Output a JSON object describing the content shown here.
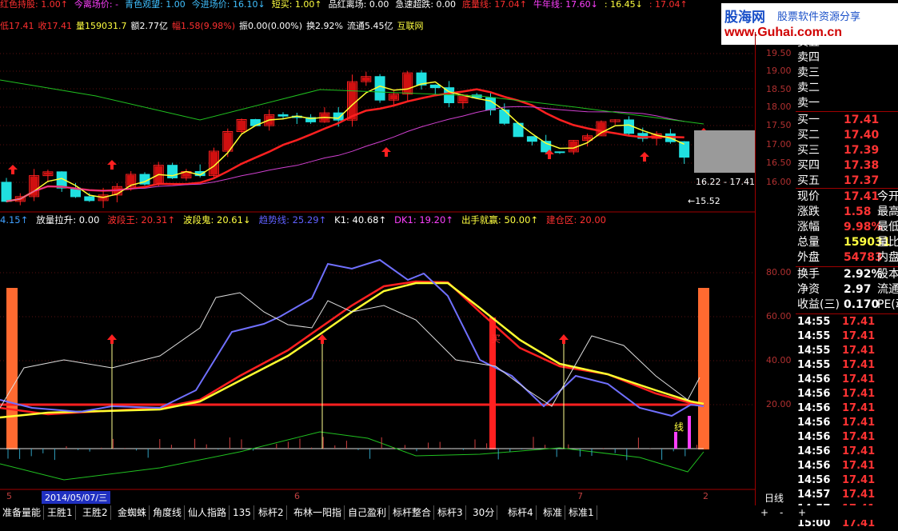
{
  "top_indicators": [
    {
      "text": "红色持股: 1.00↑",
      "color": "#ff3030"
    },
    {
      "text": "今离场价: -",
      "color": "#ff40ff"
    },
    {
      "text": "青色观望: 1.00",
      "color": "#40c0ff"
    },
    {
      "text": "今进场价: 16.10↓",
      "color": "#40c0ff"
    },
    {
      "text": "短买: 1.00↑",
      "color": "#ffff40"
    },
    {
      "text": "品红离场: 0.00",
      "color": "#ffffff"
    },
    {
      "text": "急速超跌: 0.00",
      "color": "#ffffff"
    },
    {
      "text": "底量线: 17.04↑",
      "color": "#ff3030"
    },
    {
      "text": "牛年线: 17.60↓",
      "color": "#ff40ff"
    },
    {
      "text": ": 16.45↓",
      "color": "#ffff40"
    },
    {
      "text": ": 17.04↑",
      "color": "#ff3030"
    }
  ],
  "quote_line": [
    {
      "text": "低17.41",
      "color": "#ff3030"
    },
    {
      "text": "收17.41",
      "color": "#ff3030"
    },
    {
      "text": "量159031.7",
      "color": "#ffff40"
    },
    {
      "text": "额2.77亿",
      "color": "#ffffff"
    },
    {
      "text": "幅1.58(9.98%)",
      "color": "#ff3030"
    },
    {
      "text": "振0.00(0.00%)",
      "color": "#ffffff"
    },
    {
      "text": "换2.92%",
      "color": "#ffffff"
    },
    {
      "text": "流通5.45亿",
      "color": "#ffffff"
    },
    {
      "text": "互联网",
      "color": "#ffff40"
    }
  ],
  "logo": {
    "name": "股海网",
    "slogan": "股票软件资源分享",
    "url": "www.Guhai.com.cn"
  },
  "price_axis": [
    "19.50",
    "19.00",
    "18.50",
    "18.00",
    "17.50",
    "17.00",
    "16.50",
    "16.00"
  ],
  "price_range_label": "16.22 - 17.41",
  "low_label": "←15.52",
  "indicator_row": [
    {
      "text": "4.15↑",
      "color": "#40a0ff"
    },
    {
      "text": "放量拉升: 0.00",
      "color": "#ffffff"
    },
    {
      "text": "波段王: 20.31↑",
      "color": "#ff3030"
    },
    {
      "text": "波段鬼: 20.61↓",
      "color": "#ffff40"
    },
    {
      "text": "趋势线: 25.29↑",
      "color": "#6060ff"
    },
    {
      "text": "K1: 40.68↑",
      "color": "#ffffff"
    },
    {
      "text": "DK1: 19.20↑",
      "color": "#ff40ff"
    },
    {
      "text": "出手就赢: 50.00↑",
      "color": "#ffff40"
    },
    {
      "text": "建仓区: 20.00",
      "color": "#ff3030"
    }
  ],
  "osc_axis": [
    "80.00",
    "60.00",
    "40.00",
    "20.00"
  ],
  "buy_label": "买",
  "line_label": "线",
  "sell_book": [
    {
      "k": "卖五",
      "v": ""
    },
    {
      "k": "卖四",
      "v": ""
    },
    {
      "k": "卖三",
      "v": ""
    },
    {
      "k": "卖二",
      "v": ""
    },
    {
      "k": "卖一",
      "v": ""
    }
  ],
  "buy_book": [
    {
      "k": "买一",
      "v": "17.41"
    },
    {
      "k": "买二",
      "v": "17.40"
    },
    {
      "k": "买三",
      "v": "17.39"
    },
    {
      "k": "买四",
      "v": "17.38"
    },
    {
      "k": "买五",
      "v": "17.37"
    }
  ],
  "stats": [
    {
      "k": "现价",
      "v": "17.41",
      "c": "#ff3333",
      "k2": "今开"
    },
    {
      "k": "涨跌",
      "v": "1.58",
      "c": "#ff3333",
      "k2": "最高"
    },
    {
      "k": "涨幅",
      "v": "9.98%",
      "c": "#ff3333",
      "k2": "最低"
    },
    {
      "k": "总量",
      "v": "159031",
      "c": "#ffff40",
      "k2": "量比"
    },
    {
      "k": "外盘",
      "v": "54783",
      "c": "#ff3333",
      "k2": "内盘"
    }
  ],
  "stats2": [
    {
      "k": "换手",
      "v": "2.92%",
      "c": "#ffffff",
      "k2": "股本"
    },
    {
      "k": "净资",
      "v": "2.97",
      "c": "#ffffff",
      "k2": "流通"
    },
    {
      "k": "收益(三)",
      "v": "0.170",
      "c": "#ffffff",
      "k2": "PE(动"
    }
  ],
  "ticks": [
    {
      "t": "14:55",
      "p": "17.41"
    },
    {
      "t": "14:55",
      "p": "17.41"
    },
    {
      "t": "14:55",
      "p": "17.41"
    },
    {
      "t": "14:55",
      "p": "17.41"
    },
    {
      "t": "14:56",
      "p": "17.41"
    },
    {
      "t": "14:56",
      "p": "17.41"
    },
    {
      "t": "14:56",
      "p": "17.41"
    },
    {
      "t": "14:56",
      "p": "17.41"
    },
    {
      "t": "14:56",
      "p": "17.41"
    },
    {
      "t": "14:56",
      "p": "17.41"
    },
    {
      "t": "14:56",
      "p": "17.41"
    },
    {
      "t": "14:56",
      "p": "17.41"
    },
    {
      "t": "14:57",
      "p": "17.41"
    },
    {
      "t": "14:57",
      "p": "17.41"
    },
    {
      "t": "15:00",
      "p": "17.41"
    }
  ],
  "date_axis": {
    "left": "5",
    "selected_date": "2014/05/07/三",
    "m6": "6",
    "m7": "7",
    "m2": "2"
  },
  "period_label": "日线",
  "tabs": [
    "准备量能",
    "王胜1",
    "王胜2",
    "金蜘蛛",
    "角度线",
    "仙人指路",
    "135",
    "标杆2",
    "布林一阳指",
    "自己盈利",
    "标杆整合",
    "标杆3",
    "30分",
    "标杆4",
    "标准",
    "标准1"
  ],
  "tabs_right": [
    "+",
    "-",
    "+"
  ]
}
